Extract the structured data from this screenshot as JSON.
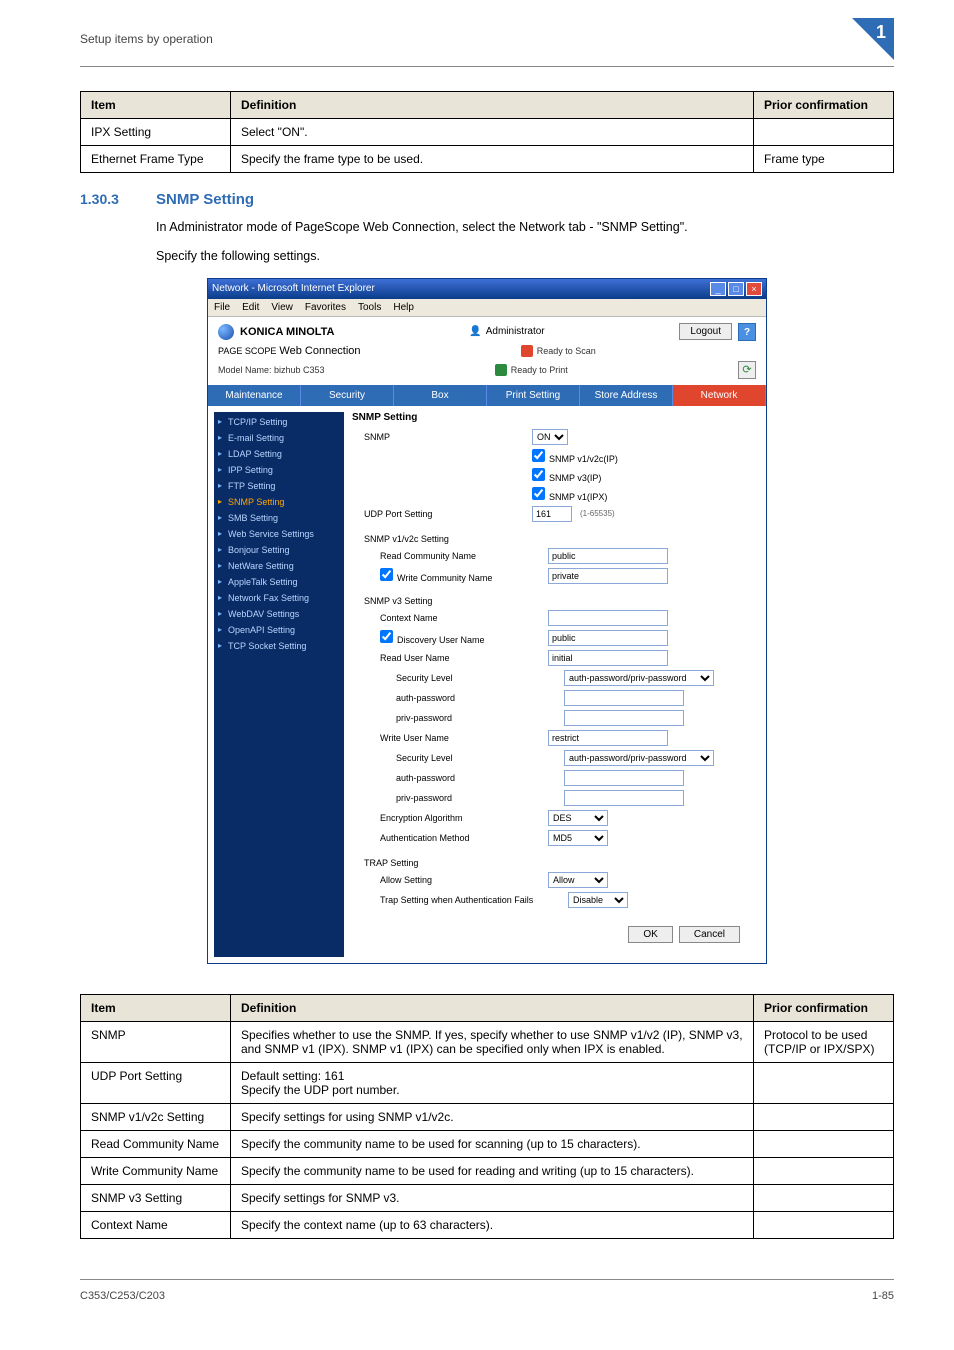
{
  "page_header": "Setup items by operation",
  "corner_number": "1",
  "table1": {
    "headers": {
      "item": "Item",
      "definition": "Definition",
      "prior": "Prior confirmation"
    },
    "rows": [
      {
        "item": "IPX Setting",
        "def": "Select \"ON\".",
        "prior": ""
      },
      {
        "item": "Ethernet Frame Type",
        "def": "Specify the frame type to be used.",
        "prior": "Frame type"
      }
    ]
  },
  "section": {
    "number": "1.30.3",
    "title": "SNMP Setting"
  },
  "body1": "In Administrator mode of PageScope Web Connection, select the Network tab - \"SNMP Setting\".",
  "body2": "Specify the following settings.",
  "screenshot": {
    "window_title": "Network - Microsoft Internet Explorer",
    "menubar": [
      "File",
      "Edit",
      "View",
      "Favorites",
      "Tools",
      "Help"
    ],
    "brand": "KONICA MINOLTA",
    "admin_label": "Administrator",
    "logout": "Logout",
    "pswc_pre": "PAGE SCOPE",
    "pswc": " Web Connection",
    "model": "Model Name: bizhub C353",
    "ready_scan": "Ready to Scan",
    "ready_print": "Ready to Print",
    "tabs": [
      "Maintenance",
      "Security",
      "Box",
      "Print Setting",
      "Store Address",
      "Network"
    ],
    "sidebar": [
      "TCP/IP Setting",
      "E-mail Setting",
      "LDAP Setting",
      "IPP Setting",
      "FTP Setting",
      "SNMP Setting",
      "SMB Setting",
      "Web Service Settings",
      "Bonjour Setting",
      "NetWare Setting",
      "AppleTalk Setting",
      "Network Fax Setting",
      "WebDAV Settings",
      "OpenAPI Setting",
      "TCP Socket Setting"
    ],
    "content_title": "SNMP Setting",
    "snmp_label": "SNMP",
    "snmp_select": "ON",
    "snmp_cb1": "SNMP v1/v2c(IP)",
    "snmp_cb2": "SNMP v3(IP)",
    "snmp_cb3": "SNMP v1(IPX)",
    "udp_label": "UDP Port Setting",
    "udp_value": "161",
    "udp_hint": "(1-65535)",
    "v12_heading": "SNMP v1/v2c Setting",
    "read_comm_label": "Read Community Name",
    "read_comm_value": "public",
    "write_comm_label": "Write Community Name",
    "write_comm_value": "private",
    "v3_heading": "SNMP v3 Setting",
    "ctx_label": "Context Name",
    "disc_label": "Discovery User Name",
    "disc_value": "public",
    "readu_label": "Read User Name",
    "readu_value": "initial",
    "sec_label": "Security Level",
    "sec_value": "auth-password/priv-password",
    "authpw_label": "auth-password",
    "privpw_label": "priv-password",
    "writeu_label": "Write User Name",
    "writeu_value": "restrict",
    "enc_label": "Encryption Algorithm",
    "enc_value": "DES",
    "authm_label": "Authentication Method",
    "authm_value": "MD5",
    "trap_heading": "TRAP Setting",
    "allow_label": "Allow Setting",
    "allow_value": "Allow",
    "trapfail_label": "Trap Setting when Authentication Fails",
    "trapfail_value": "Disable",
    "ok": "OK",
    "cancel": "Cancel"
  },
  "table2": {
    "headers": {
      "item": "Item",
      "definition": "Definition",
      "prior": "Prior confirmation"
    },
    "rows": [
      {
        "item": "SNMP",
        "def": "Specifies whether to use the SNMP. If yes, specify whether to use SNMP v1/v2 (IP), SNMP v3, and SNMP v1 (IPX). SNMP v1 (IPX) can be specified only when IPX is enabled.",
        "prior": "Protocol to be used (TCP/IP or IPX/SPX)"
      },
      {
        "item": "UDP Port Setting",
        "def": "Default setting: 161\nSpecify the UDP port number.",
        "prior": ""
      },
      {
        "item": "SNMP v1/v2c Setting",
        "def": "Specify settings for using SNMP v1/v2c.",
        "prior": ""
      },
      {
        "item": "Read Community Name",
        "def": "Specify the community name to be used for scanning (up to 15 characters).",
        "prior": ""
      },
      {
        "item": "Write Community Name",
        "def": "Specify the community name to be used for reading and writing (up to 15 characters).",
        "prior": ""
      },
      {
        "item": "SNMP v3 Setting",
        "def": "Specify settings for SNMP v3.",
        "prior": ""
      },
      {
        "item": "Context Name",
        "def": "Specify the context name (up to 63 characters).",
        "prior": ""
      }
    ]
  },
  "footer_left": "C353/C253/C203",
  "footer_right": "1-85"
}
